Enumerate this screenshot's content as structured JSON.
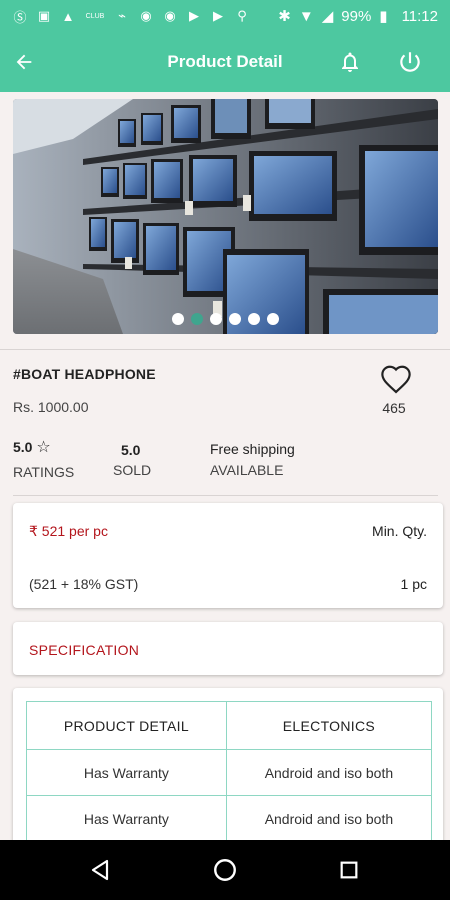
{
  "status_bar": {
    "battery": "99%",
    "time": "11:12"
  },
  "header": {
    "title": "Product Detail"
  },
  "carousel": {
    "dot_count": 6,
    "active_index": 1
  },
  "product": {
    "name": "#BOAT HEADPHONE",
    "price": "Rs. 1000.00",
    "likes": "465",
    "rating_value": "5.0",
    "rating_label": "RATINGS",
    "sold_value": "5.0",
    "sold_label": "SOLD",
    "shipping_value": "Free shipping",
    "shipping_label": "AVAILABLE"
  },
  "pricing": {
    "price_per": "₹ 521 per pc",
    "min_qty_label": "Min. Qty.",
    "gst": "(521 + 18% GST)",
    "min_qty_value": "1 pc"
  },
  "specification": {
    "title": "SPECIFICATION"
  },
  "spec_table": {
    "headers": [
      "PRODUCT DETAIL",
      "ELECTONICS"
    ],
    "rows": [
      [
        "Has Warranty",
        "Android and iso both"
      ],
      [
        "Has Warranty",
        "Android and iso both"
      ],
      [
        "",
        ""
      ]
    ]
  },
  "colors": {
    "accent": "#4dc8a0",
    "price_red": "#b3151c",
    "table_border": "#8ed7c3"
  }
}
